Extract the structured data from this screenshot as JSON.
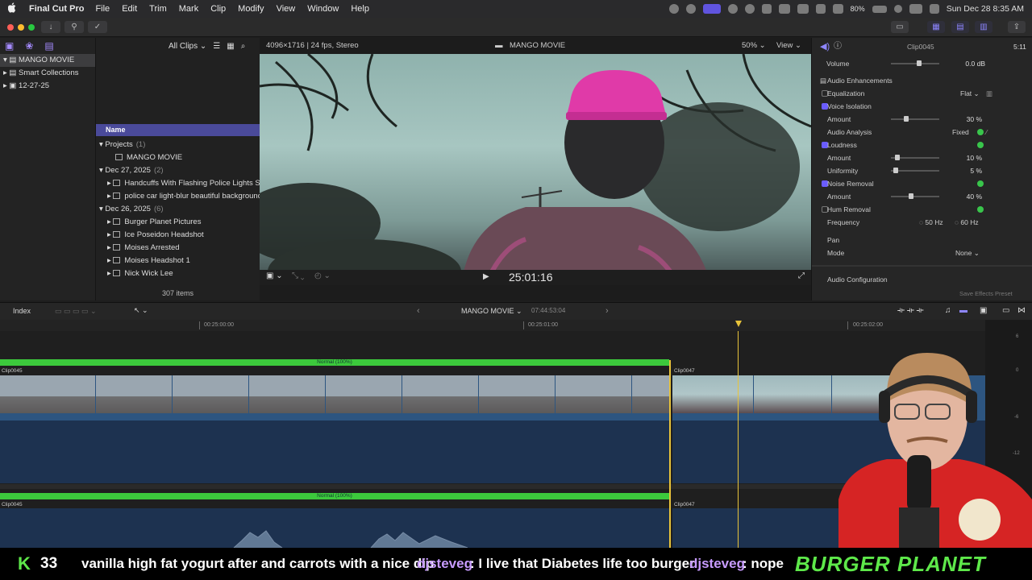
{
  "menubar": {
    "app_name": "Final Cut Pro",
    "menus": [
      "File",
      "Edit",
      "Trim",
      "Mark",
      "Clip",
      "Modify",
      "View",
      "Window",
      "Help"
    ],
    "battery": "80%",
    "datetime": "Sun Dec 28  8:35 AM"
  },
  "libraries": {
    "items": [
      {
        "label": "MANGO MOVIE",
        "selected": true
      },
      {
        "label": "Smart Collections"
      },
      {
        "label": "12-27-25"
      }
    ]
  },
  "browser": {
    "filter_label": "All Clips",
    "column_name": "Name",
    "groups": [
      {
        "label": "Projects",
        "count": "(1)",
        "items": [
          "MANGO MOVIE"
        ]
      },
      {
        "label": "Dec 27, 2025",
        "count": "(2)",
        "items": [
          "Handcuffs With Flashing Police Lights Sto",
          "police car light-blur beautiful background"
        ]
      },
      {
        "label": "Dec 26, 2025",
        "count": "(6)",
        "items": [
          "Burger Planet Pictures",
          "Ice Poseidon Headshot",
          "Moises Arrested",
          "Moises Headshot 1",
          "Nick Wick Lee"
        ]
      }
    ],
    "items_count": "307 items"
  },
  "viewer": {
    "format": "4096×1716 | 24 fps, Stereo",
    "title": "MANGO MOVIE",
    "zoom": "50%",
    "view_label": "View",
    "timecode": "25:01:16"
  },
  "inspector": {
    "clip_name": "Clip0045",
    "duration": "5:11",
    "volume_label": "Volume",
    "volume_value": "0.0 dB",
    "section_title": "Audio Enhancements",
    "equalization_label": "Equalization",
    "equalization_value": "Flat",
    "voice_isolation_label": "Voice Isolation",
    "voice_amount_label": "Amount",
    "voice_amount_value": "30",
    "voice_amount_pct": 30,
    "audio_analysis_label": "Audio Analysis",
    "audio_analysis_value": "Fixed",
    "loudness_label": "Loudness",
    "loud_amount_label": "Amount",
    "loud_amount_value": "10",
    "loud_amount_pct": 10,
    "uniformity_label": "Uniformity",
    "uniformity_value": "5",
    "uniformity_pct": 5,
    "noise_label": "Noise Removal",
    "noise_amount_label": "Amount",
    "noise_amount_value": "40",
    "noise_amount_pct": 40,
    "hum_label": "Hum Removal",
    "frequency_label": "Frequency",
    "freq_50": "50",
    "freq_60": "60",
    "hz": "Hz",
    "pct": "%",
    "pan_label": "Pan",
    "mode_label": "Mode",
    "mode_value": "None",
    "audio_config_label": "Audio Configuration",
    "save_preset_label": "Save Effects Preset"
  },
  "timeline": {
    "index_label": "Index",
    "project_name": "MANGO MOVIE",
    "duration": "07:44:53:04",
    "ruler": [
      "00:25:00:00",
      "00:25:01:00",
      "00:25:02:00"
    ],
    "retime_label": "Normal (100%)",
    "clip_a": "Clip0045",
    "clip_b": "Clip0047"
  },
  "meters": {
    "labels": [
      "6",
      "0",
      "-6",
      "-12"
    ]
  },
  "chat": {
    "k_letter": "K",
    "count": "33",
    "message1": "vanilla high fat yogurt after and carrots with a nice dip",
    "user2": "djsteveg",
    "message2": ": I live that Diabetes life too burger",
    "user3": "djsteveg",
    "message3": ": nope",
    "brand": "BURGER PLANET"
  },
  "colors": {
    "accent": "#6a5cff",
    "retime": "#3cc93c",
    "chat_user": "#c79bff",
    "brand": "#5ee84a"
  }
}
